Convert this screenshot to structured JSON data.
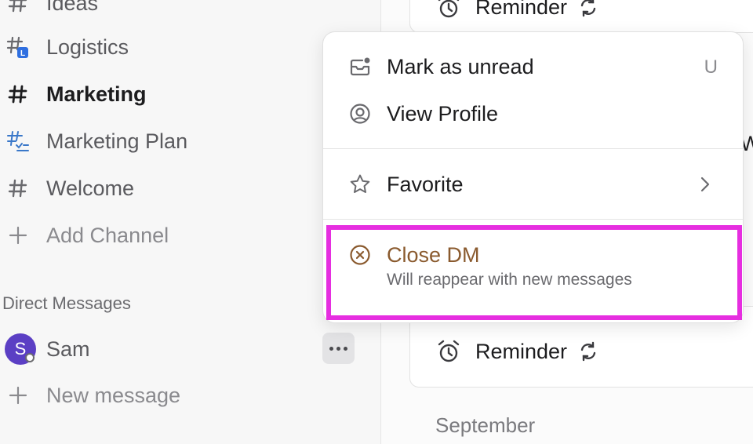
{
  "sidebar": {
    "channels": [
      {
        "label": "Ideas",
        "icon": "hash-icon"
      },
      {
        "label": "Logistics",
        "icon": "hash-list-icon",
        "badge": "L"
      },
      {
        "label": "Marketing",
        "icon": "hash-icon"
      },
      {
        "label": "Marketing Plan",
        "icon": "hash-checklist-icon"
      },
      {
        "label": "Welcome",
        "icon": "hash-icon"
      },
      {
        "label": "Add Channel",
        "icon": "plus-icon"
      }
    ],
    "dm_section_title": "Direct Messages",
    "dms": [
      {
        "name": "Sam",
        "initial": "S"
      }
    ],
    "new_message": "New message"
  },
  "main": {
    "reminder_top": "Reminder",
    "reminder_bottom": "Reminder",
    "peek_char": "W",
    "month": "September"
  },
  "context_menu": {
    "mark_unread": {
      "label": "Mark as unread",
      "shortcut": "U"
    },
    "view_profile": {
      "label": "View Profile"
    },
    "favorite": {
      "label": "Favorite"
    },
    "close_dm": {
      "label": "Close DM",
      "sub": "Will reappear with new messages"
    }
  },
  "colors": {
    "avatar": "#5b3fc4",
    "badge": "#2f6fe0",
    "close": "#8a5a2e",
    "highlight": "#e62ee0"
  }
}
